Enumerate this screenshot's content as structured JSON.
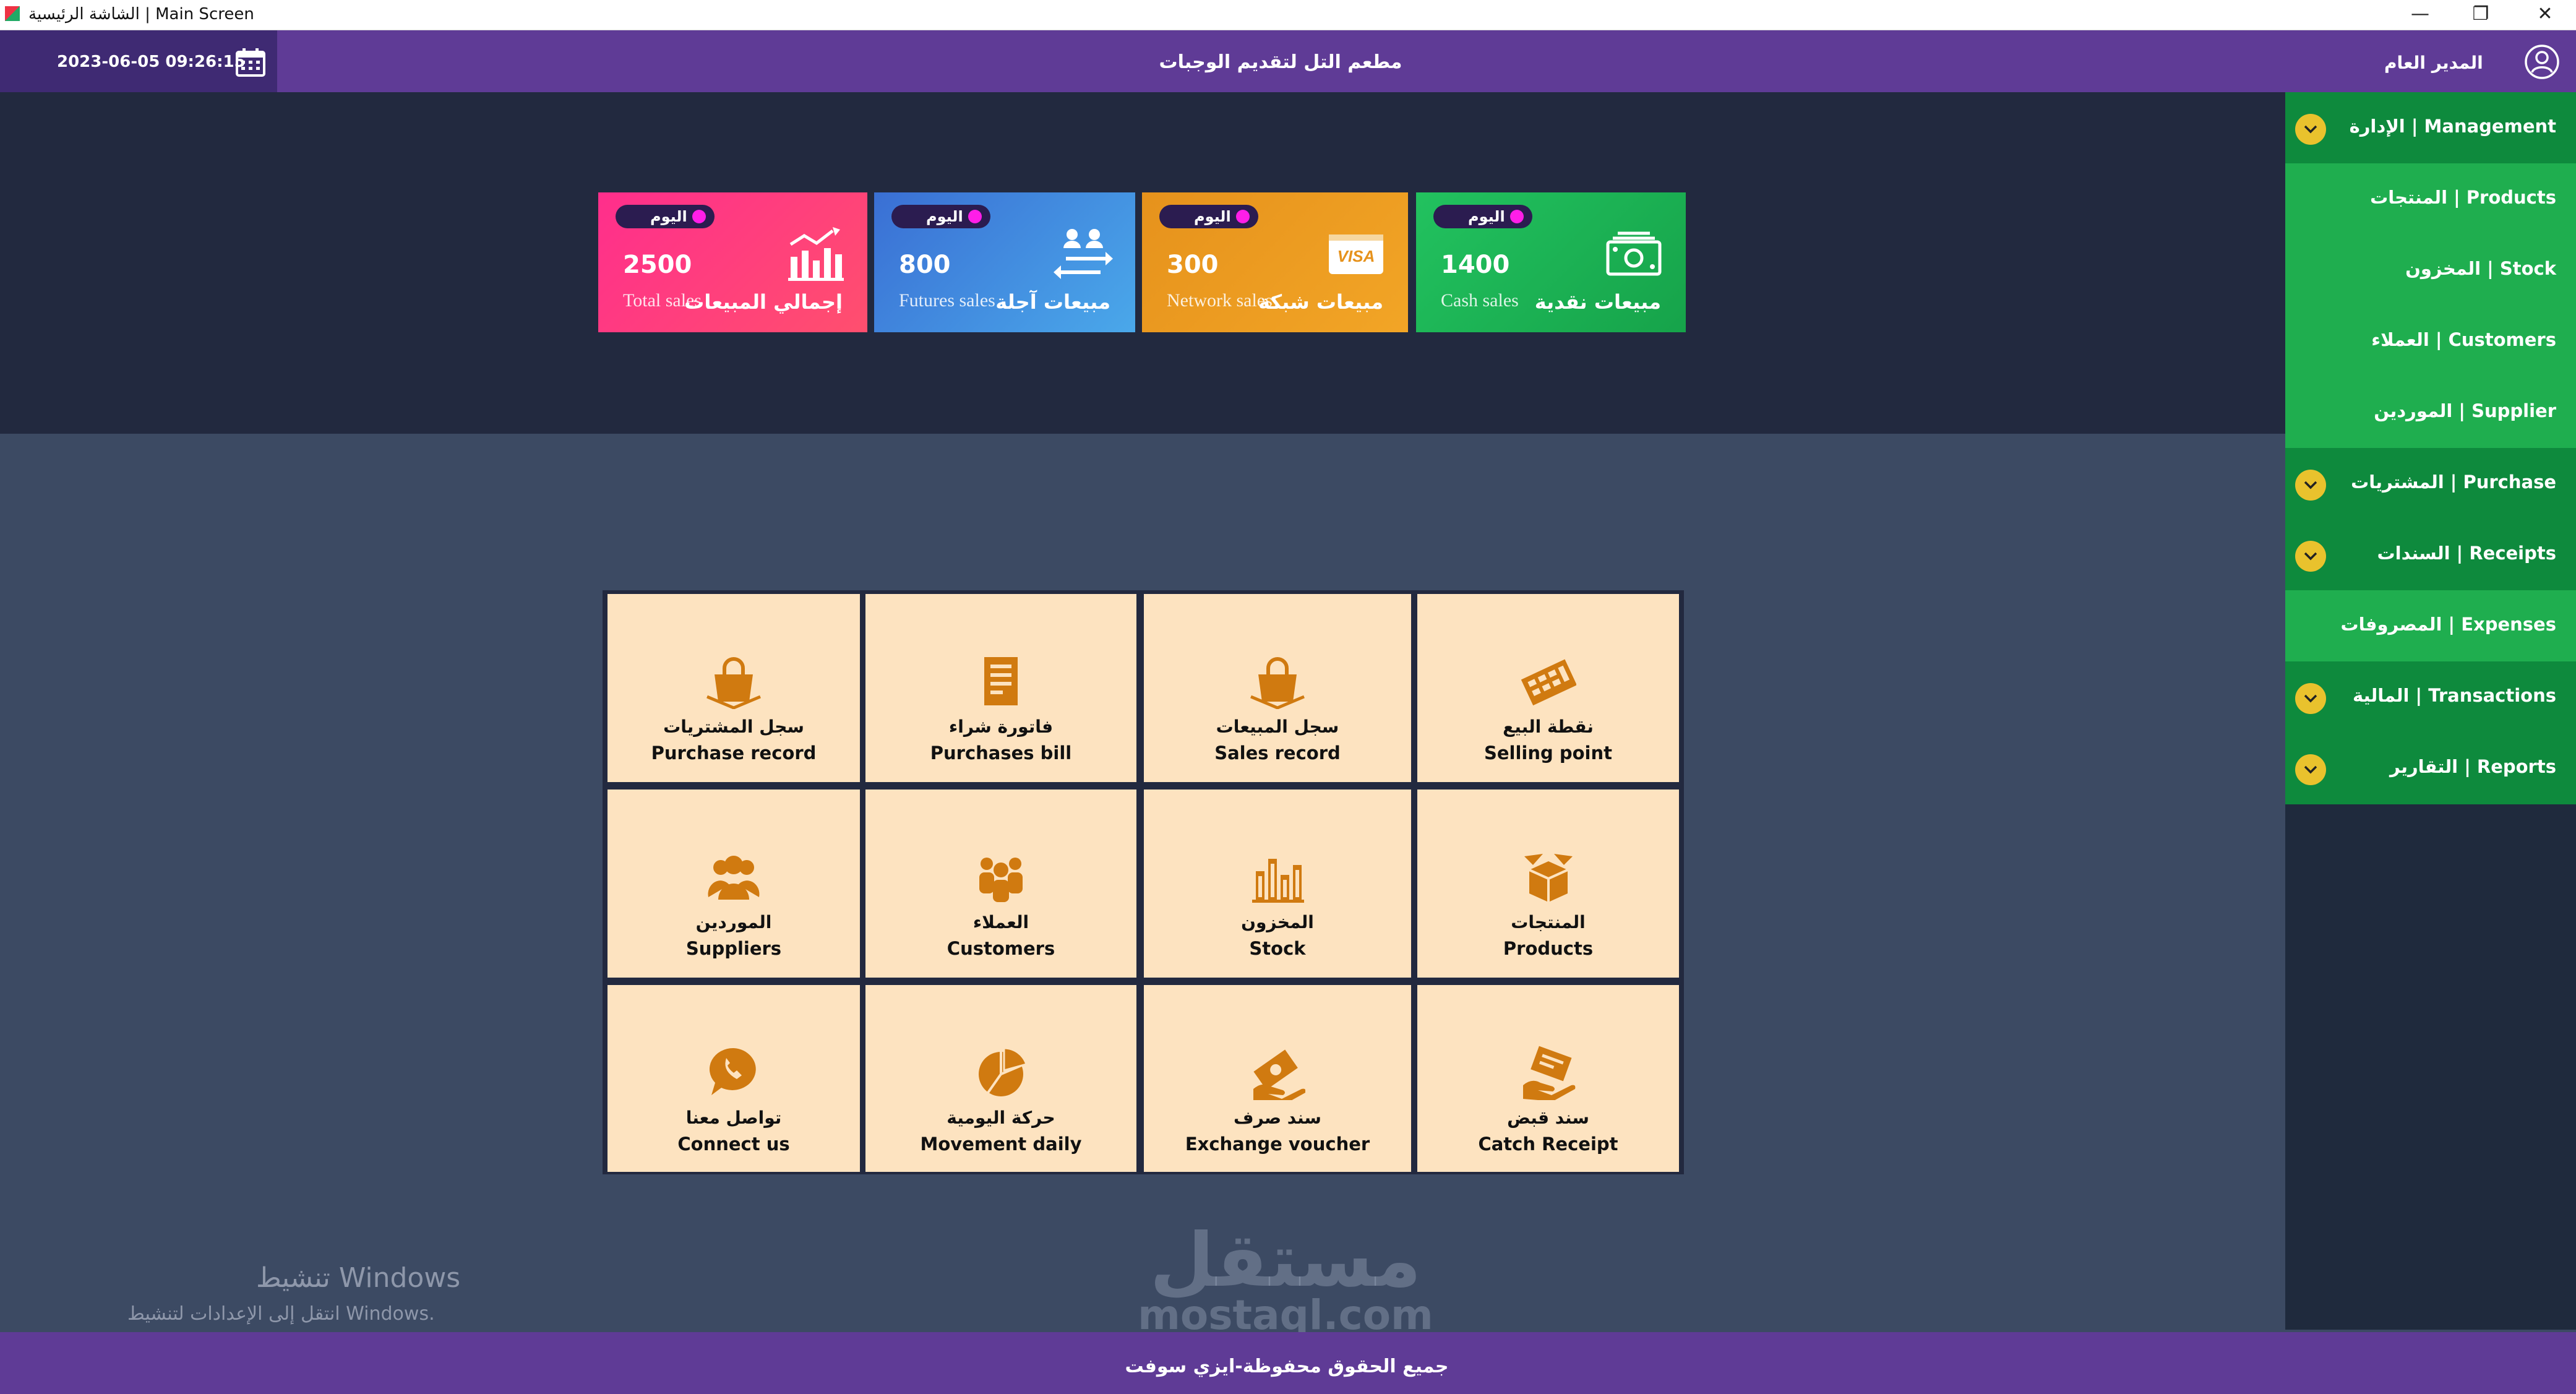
{
  "window": {
    "title": "الشاشة الرئيسية | Main Screen",
    "minimize": "—",
    "restore": "❐",
    "close": "✕"
  },
  "header": {
    "datetime": "2023-06-05 09:26:15",
    "restaurant_name": "مطعم التل لتقديم الوجبات",
    "user_role": "المدير العام"
  },
  "sidebar": {
    "items": [
      {
        "label": "الإدارة | Management",
        "chevron": true,
        "shade": "dark"
      },
      {
        "label": "المنتجات | Products",
        "chevron": false,
        "shade": "light"
      },
      {
        "label": "المخزون | Stock",
        "chevron": false,
        "shade": "light"
      },
      {
        "label": "العملاء | Customers",
        "chevron": false,
        "shade": "light"
      },
      {
        "label": "الموردين | Supplier",
        "chevron": false,
        "shade": "light"
      },
      {
        "label": "المشتريات | Purchase",
        "chevron": true,
        "shade": "dark"
      },
      {
        "label": "السندات | Receipts",
        "chevron": true,
        "shade": "dark"
      },
      {
        "label": "المصروفات | Expenses",
        "chevron": false,
        "shade": "light"
      },
      {
        "label": "المالية | Transactions",
        "chevron": true,
        "shade": "dark"
      },
      {
        "label": "التقارير | Reports",
        "chevron": true,
        "shade": "dark"
      }
    ]
  },
  "stats": {
    "badge_label": "اليوم",
    "cards": [
      {
        "value": "2500",
        "en": "Total sales",
        "ar": "إجمالي المبيعات",
        "color_from": "#ff2e8c",
        "color_to": "#ff4f6e"
      },
      {
        "value": "800",
        "en": "Futures sales",
        "ar": "مبيعات آجلة",
        "color_from": "#3a7ad8",
        "color_to": "#4aa3e8"
      },
      {
        "value": "300",
        "en": "Network sales",
        "ar": "مبيعات شبكة",
        "color_from": "#e69a1e",
        "color_to": "#f0a322"
      },
      {
        "value": "1400",
        "en": "Cash sales",
        "ar": "مبيعات نقدية",
        "color_from": "#1fbf5c",
        "color_to": "#16a34a"
      }
    ],
    "visa_text": "VISA"
  },
  "tiles": [
    {
      "ar": "سجل المشتريات",
      "en": "Purchase record",
      "icon": "shopping-bag-icon"
    },
    {
      "ar": "فاتورة شراء",
      "en": "Purchases bill",
      "icon": "invoice-icon"
    },
    {
      "ar": "سجل المبيعات",
      "en": "Sales record",
      "icon": "shopping-bag-icon"
    },
    {
      "ar": "نقطة البيع",
      "en": "Selling point",
      "icon": "cash-register-icon"
    },
    {
      "ar": "الموردين",
      "en": "Suppliers",
      "icon": "suppliers-icon"
    },
    {
      "ar": "العملاء",
      "en": "Customers",
      "icon": "customers-icon"
    },
    {
      "ar": "المخزون",
      "en": "Stock",
      "icon": "stock-chart-icon"
    },
    {
      "ar": "المنتجات",
      "en": "Products",
      "icon": "product-box-icon"
    },
    {
      "ar": "تواصل معنا",
      "en": "Connect us",
      "icon": "phone-chat-icon"
    },
    {
      "ar": "حركة اليومية",
      "en": "Movement daily",
      "icon": "pie-chart-icon"
    },
    {
      "ar": "سند صرف",
      "en": "Exchange voucher",
      "icon": "money-hand-icon"
    },
    {
      "ar": "سند قبض",
      "en": "Catch Receipt",
      "icon": "receipt-hand-icon"
    }
  ],
  "accent_icon_color": "#d07a10",
  "watermark": {
    "title": "تنشيط Windows",
    "subtitle": "انتقل إلى الإعدادات لتنشيط Windows."
  },
  "brand": {
    "name_ar": "مستقل",
    "name_en": "mostaql.com"
  },
  "footer": {
    "text": "جميع الحقوق محفوظة-ايزي سوفت"
  }
}
